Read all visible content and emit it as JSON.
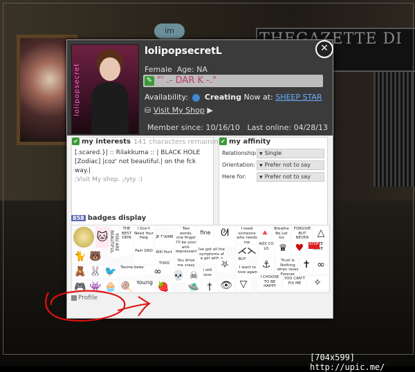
{
  "background": {
    "logo_text": "im",
    "poster_text": "THEGAZETTE DI"
  },
  "profile": {
    "username": "lolipopsecretL",
    "gender": "Female",
    "age": "Age: NA",
    "tagline": "\"' .- DAR K -.\"",
    "availability_label": "Availability:",
    "status": "Creating",
    "now_at": "Now at:",
    "room": "SHEEP STAR",
    "shop_label": "Visit My Shop",
    "member_since": "Member since: 10/16/10",
    "last_online": "Last online: 04/28/13",
    "avatar_side_text": "lolipopsecret"
  },
  "interests": {
    "title": "my interests",
    "chars_left": "141 characters remaining",
    "text": "[.scared.}| :: Rilakkuma :: | BLACK HOLE [Zodiac] |coz' not beautiful.| on the fck way.|",
    "faded": ";Visit My shop. ;/yty :)"
  },
  "affinity": {
    "title": "my affinity",
    "rows": [
      {
        "label": "Relationship:",
        "value": "Single"
      },
      {
        "label": "Orientation:",
        "value": "Prefer not to say"
      },
      {
        "label": "Here for:",
        "value": "Prefer not to say"
      }
    ]
  },
  "badges": {
    "title": "badges display",
    "count": "858",
    "items": {
      "b1": "I Don't Need Your Help",
      "b2": "Two words, one finger",
      "b3": "fine",
      "b4": "I need someone who needs me",
      "b5": "Breathe Be Let Go",
      "b6": "FORGIVE BUT NEVER FORGET",
      "b7": "YOU ARE BEAUTIFUL",
      "b8": "THE BEST DEIN",
      "b9": "JE T'AIME",
      "b10": "I'll be your anti-depressant",
      "b11": "Ive got all the symptoms of a girl with a",
      "b12": "BUY",
      "b13": "Will Hurt",
      "b14": "AIDI CO LO",
      "b15": "HATE LOVE",
      "b16": "STOP",
      "b17": "Pain GRO",
      "b18": "TOXIC",
      "b19": "You drive me crazy",
      "b20": "I want to love again",
      "b21": "Trust is Nothing when loses Forever",
      "b22": "YOU CAN'T FIX ME",
      "b23": "Young",
      "b24": "I CHOOSE TO BE HAPPY",
      "b25": "Teome bebe",
      "b26": "i still love"
    }
  },
  "footer": {
    "profile_tab": "Profile"
  },
  "watermark": "[704x599] http://upic.me/",
  "colors": {
    "header_bg": "#3b3b3b",
    "link": "#6ab0ff",
    "tagline_text": "#c03a66",
    "check_green": "#3a9a3a",
    "scribble": "#e01010"
  }
}
